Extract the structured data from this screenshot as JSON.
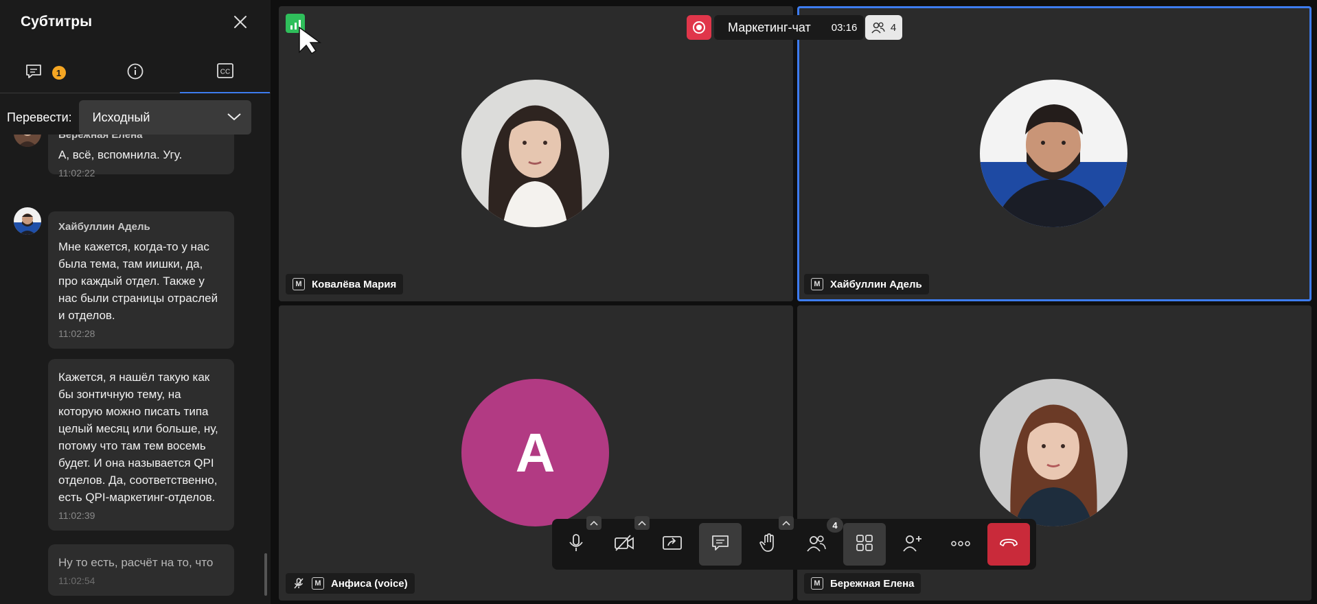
{
  "sidebar": {
    "title": "Субтитры",
    "tabs": [
      {
        "icon": "chat-icon",
        "badge": "1"
      },
      {
        "icon": "info-icon"
      },
      {
        "icon": "cc-icon"
      }
    ],
    "translate_label": "Перевести:",
    "translate_value": "Исходный",
    "messages": [
      {
        "author": "Бережная Елена",
        "text": "А, всё, вспомнила. Угу.",
        "time": "11:02:22"
      },
      {
        "author": "Хайбуллин Адель",
        "text": "Мне кажется, когда-то у нас была тема, там иишки, да, про каждый отдел. Также у нас были страницы отраслей и отделов.",
        "time": "11:02:28"
      },
      {
        "author": "",
        "text": "Кажется, я нашёл такую как бы зонтичную тему, на которую можно писать типа целый месяц или больше, ну, потому что там тем восемь будет. И она называется QPI отделов. Да, соответственно, есть QPI-маркетинг-отделов.",
        "time": "11:02:39"
      },
      {
        "author": "",
        "text": "Ну то есть, расчёт на то, что",
        "time": "11:02:54"
      }
    ]
  },
  "header": {
    "meeting_title": "Маркетинг-чат",
    "timer": "03:16",
    "participant_count": "4"
  },
  "participants": [
    {
      "name": "Ковалёва Мария",
      "badge": "M"
    },
    {
      "name": "Хайбуллин Адель",
      "badge": "M",
      "speaking": true
    },
    {
      "name": "Анфиса (voice)",
      "badge": "M",
      "initial": "А",
      "avatar_color": "#b23a83",
      "muted": true
    },
    {
      "name": "Бережная Елена",
      "badge": "M"
    }
  ],
  "toolbar": {
    "participants_badge": "4",
    "buttons": [
      "mic-icon",
      "camera-off-icon",
      "share-screen-icon",
      "chat-icon",
      "raise-hand-icon",
      "participants-icon",
      "grid-layout-icon",
      "add-user-icon",
      "more-icon",
      "end-call-icon"
    ]
  },
  "colors": {
    "accent": "#3d7cf0",
    "record": "#e0364a",
    "end_call": "#c92a3a",
    "badge": "#f5a623",
    "signal": "#2fbf5b"
  }
}
